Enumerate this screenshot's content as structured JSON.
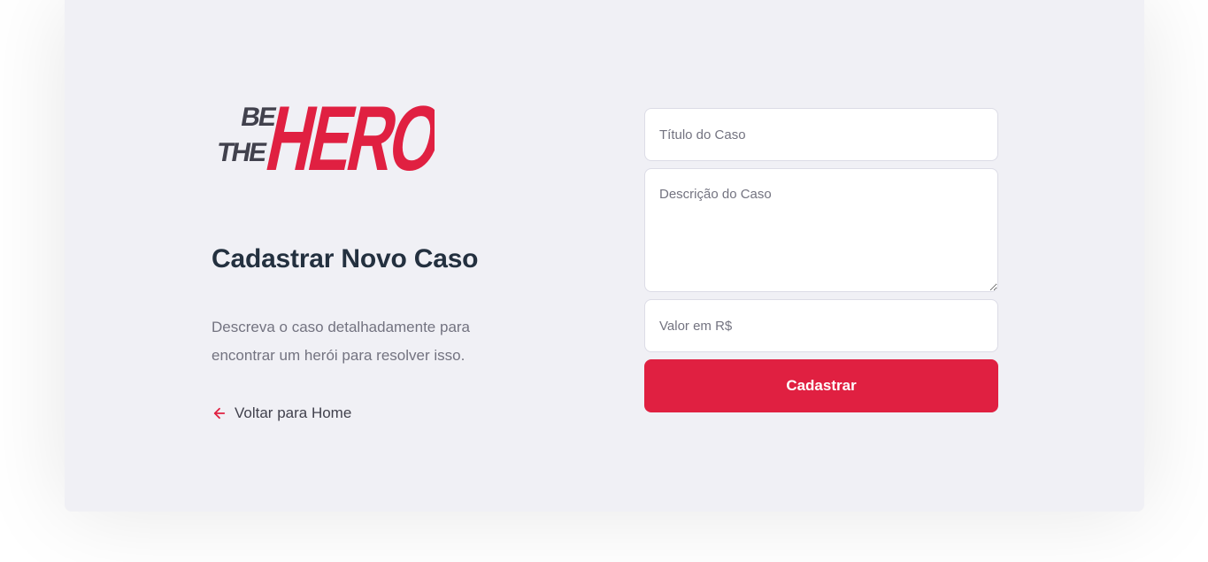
{
  "brand": {
    "logo_line1": "BE",
    "logo_line2": "THE",
    "logo_word": "HERO",
    "logo_dark_color": "#41414d",
    "logo_accent_color": "#e02041"
  },
  "intro": {
    "title": "Cadastrar Novo Caso",
    "description": "Descreva o caso detalhadamente para encontrar um herói para resolver isso.",
    "back_link_label": "Voltar para Home",
    "back_icon": "arrow-left-icon"
  },
  "form": {
    "title_placeholder": "Título do Caso",
    "title_value": "",
    "description_placeholder": "Descrição do Caso",
    "description_value": "",
    "value_placeholder": "Valor em R$",
    "value_value": "",
    "submit_label": "Cadastrar"
  },
  "colors": {
    "background": "#f0f0f5",
    "accent": "#e02041",
    "heading": "#23303f",
    "muted_text": "#737380"
  }
}
